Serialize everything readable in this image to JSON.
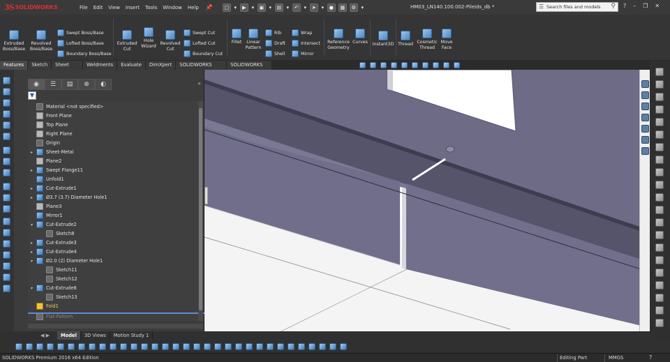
{
  "app": {
    "logo_mark": "3S",
    "logo_text": "SOLIDWORKS",
    "menu": [
      "File",
      "Edit",
      "View",
      "Insert",
      "Tools",
      "Window",
      "Help"
    ],
    "document_title": "HM03_LN140.100.002-Pileids_db *",
    "search_placeholder": "Search files and models"
  },
  "command_manager": {
    "buttons": [
      {
        "label_lines": [
          "Extruded",
          "Boss/Base"
        ]
      },
      {
        "label_lines": [
          "Revolved",
          "Boss/Base"
        ]
      },
      {
        "label_lines": [
          "Extruded",
          "Cut"
        ]
      },
      {
        "label_lines": [
          "Hole",
          "Wizard"
        ]
      },
      {
        "label_lines": [
          "Revolved",
          "Cut"
        ]
      },
      {
        "label_lines": [
          "Fillet"
        ]
      },
      {
        "label_lines": [
          "Linear",
          "Pattern"
        ]
      },
      {
        "label_lines": [
          "Reference",
          "Geometry"
        ]
      },
      {
        "label_lines": [
          "Curves"
        ]
      },
      {
        "label_lines": [
          "Instant3D"
        ]
      },
      {
        "label_lines": [
          "Thread"
        ]
      },
      {
        "label_lines": [
          "Cosmetic",
          "Thread"
        ]
      },
      {
        "label_lines": [
          "Move",
          "Face"
        ]
      }
    ],
    "small": {
      "swept_boss": "Swept Boss/Base",
      "lofted_boss": "Lofted Boss/Base",
      "boundary_boss": "Boundary Boss/Base",
      "swept_cut": "Swept Cut",
      "lofted_cut": "Lofted Cut",
      "boundary_cut": "Boundary Cut",
      "rib": "Rib",
      "draft": "Draft",
      "shell": "Shell",
      "wrap": "Wrap",
      "intersect": "Intersect",
      "mirror": "Mirror"
    }
  },
  "tabs": [
    "Features",
    "Sketch",
    "Sheet Metal",
    "Weldments",
    "Evaluate",
    "DimXpert",
    "SOLIDWORKS Add-Ins",
    "SOLIDWORKS MBD"
  ],
  "tree": [
    {
      "label": "Material <not specified>"
    },
    {
      "label": "Front Plane"
    },
    {
      "label": "Top Plane"
    },
    {
      "label": "Right Plane"
    },
    {
      "label": "Origin"
    },
    {
      "label": "Sheet-Metal"
    },
    {
      "label": "Plane2"
    },
    {
      "label": "Swept Flange11"
    },
    {
      "label": "Unfold1"
    },
    {
      "label": "Cut-Extrude1"
    },
    {
      "label": "Ø3.7 (3.7) Diameter Hole1"
    },
    {
      "label": "Plane3"
    },
    {
      "label": "Mirror1"
    },
    {
      "label": "Cut-Extrude2"
    },
    {
      "label": "Sketch8"
    },
    {
      "label": "Cut-Extrude3"
    },
    {
      "label": "Cut-Extrude4"
    },
    {
      "label": "Ø2.0 (2) Diameter Hole1"
    },
    {
      "label": "Sketch11"
    },
    {
      "label": "Sketch12"
    },
    {
      "label": "Cut-Extrude8"
    },
    {
      "label": "Sketch13"
    },
    {
      "label": "Fold1"
    },
    {
      "label": "Flat-Pattern"
    }
  ],
  "bottom_tabs": [
    "Model",
    "3D Views",
    "Motion Study 1"
  ],
  "status": {
    "left": "SOLIDWORKS Premium 2016 x64 Edition",
    "mode": "Editing Part",
    "units": "MMGS",
    "help": "?"
  }
}
